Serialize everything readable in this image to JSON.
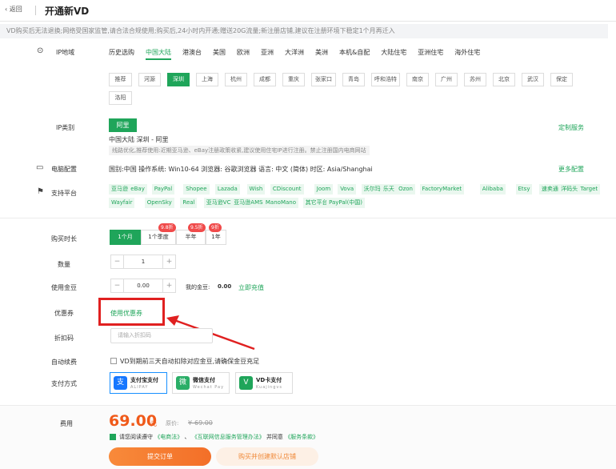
{
  "header": {
    "back": "返回",
    "title": "开通新VD"
  },
  "notice": "VD购买后无法退换;网络受国家监管,请合法合规使用;购买后,24小时内开通;赠送20G流量;新注册店铺,建议在注册环境下稳定1个月再迁入",
  "ip_region": {
    "label": "IP地域",
    "tabs": [
      "历史选购",
      "中国大陆",
      "港澳台",
      "美国",
      "欧洲",
      "亚洲",
      "大洋洲",
      "美洲",
      "本机&自配",
      "大陆住宅",
      "亚洲住宅",
      "海外住宅"
    ],
    "active_tab": "中国大陆",
    "cities": [
      "推荐",
      "河源",
      "深圳",
      "上海",
      "杭州",
      "成都",
      "重庆",
      "张家口",
      "青岛",
      "呼和浩特",
      "南京",
      "广州",
      "苏州",
      "北京",
      "武汉",
      "保定",
      "洛阳"
    ],
    "active_city": "深圳"
  },
  "ip_type": {
    "label": "IP类别",
    "selected": "阿里",
    "custom_link": "定制服务",
    "desc": "中国大陆 深圳 - 阿里",
    "hint": "线路优化,推荐使用:近期亚马逊、eBay注册政策收紧,建议使用住宅IP进行注册。禁止注册国内电商网站"
  },
  "config": {
    "label": "电脑配置",
    "text": "国别:中国 操作系统: Win10-64 浏览器: 谷歌浏览器 语言: 中文 (简体) 时区: Asia/Shanghai",
    "more_link": "更多配置"
  },
  "platforms": {
    "label": "支持平台",
    "items": [
      "亚马逊",
      "eBay",
      "PayPal",
      "Shopee",
      "Lazada",
      "Wish",
      "CDiscount",
      "Joom",
      "Vova",
      "沃尔玛",
      "乐天",
      "Ozon",
      "FactoryMarket",
      "Alibaba",
      "Etsy",
      "速卖通",
      "洋码头",
      "Target",
      "Wayfair",
      "OpenSky",
      "Real",
      "亚马逊VC",
      "亚马逊AMS",
      "ManoMano",
      "其它平台",
      "PayPal(中国)"
    ]
  },
  "duration": {
    "label": "购买时长",
    "options": [
      {
        "label": "1个月",
        "badge": ""
      },
      {
        "label": "1个季度",
        "badge": "9.8折"
      },
      {
        "label": "半年",
        "badge": "9.5折"
      },
      {
        "label": "1年",
        "badge": "9折"
      }
    ],
    "selected": "1个月"
  },
  "quantity": {
    "label": "数量",
    "value": "1",
    "minus": "−",
    "plus": "+"
  },
  "beans": {
    "label": "使用金豆",
    "value": "0.00",
    "mine_label": "我的金豆:",
    "mine_value": "0.00",
    "recharge": "立即充值"
  },
  "coupon": {
    "label": "优惠券",
    "link": "使用优惠券"
  },
  "discount": {
    "label": "折扣码",
    "placeholder": "请输入折扣码"
  },
  "autorenew": {
    "label": "自动续费",
    "text": "VD到期前三天自动扣除对应金豆,请确保金豆充足"
  },
  "payment": {
    "label": "支付方式",
    "methods": [
      {
        "name": "支付宝支付",
        "sub": "ALIPAY",
        "color": "#1677ff",
        "icon": "支"
      },
      {
        "name": "微信支付",
        "sub": "Wechat Pay",
        "color": "#2aae67",
        "icon": "微"
      },
      {
        "name": "VD卡支付",
        "sub": "Kuajingvs",
        "color": "#1fa55a",
        "icon": "V"
      }
    ]
  },
  "cost": {
    "label": "费用",
    "price": "69.00",
    "unit": "元",
    "orig_label": "原价:",
    "orig_value": "¥-69.00"
  },
  "agreement": {
    "prefix": "请您阅读遵守",
    "l1": "《电商法》",
    "mid": "、",
    "l2": "《互联网信息服务管理办法》",
    "and": "并同意",
    "l3": "《服务条款》"
  },
  "actions": {
    "submit": "提交订单",
    "submit2": "购买并创建默认店铺"
  },
  "colors": {
    "accent": "#1fa55a",
    "price": "#f05a1a",
    "highlight": "#e02020"
  }
}
